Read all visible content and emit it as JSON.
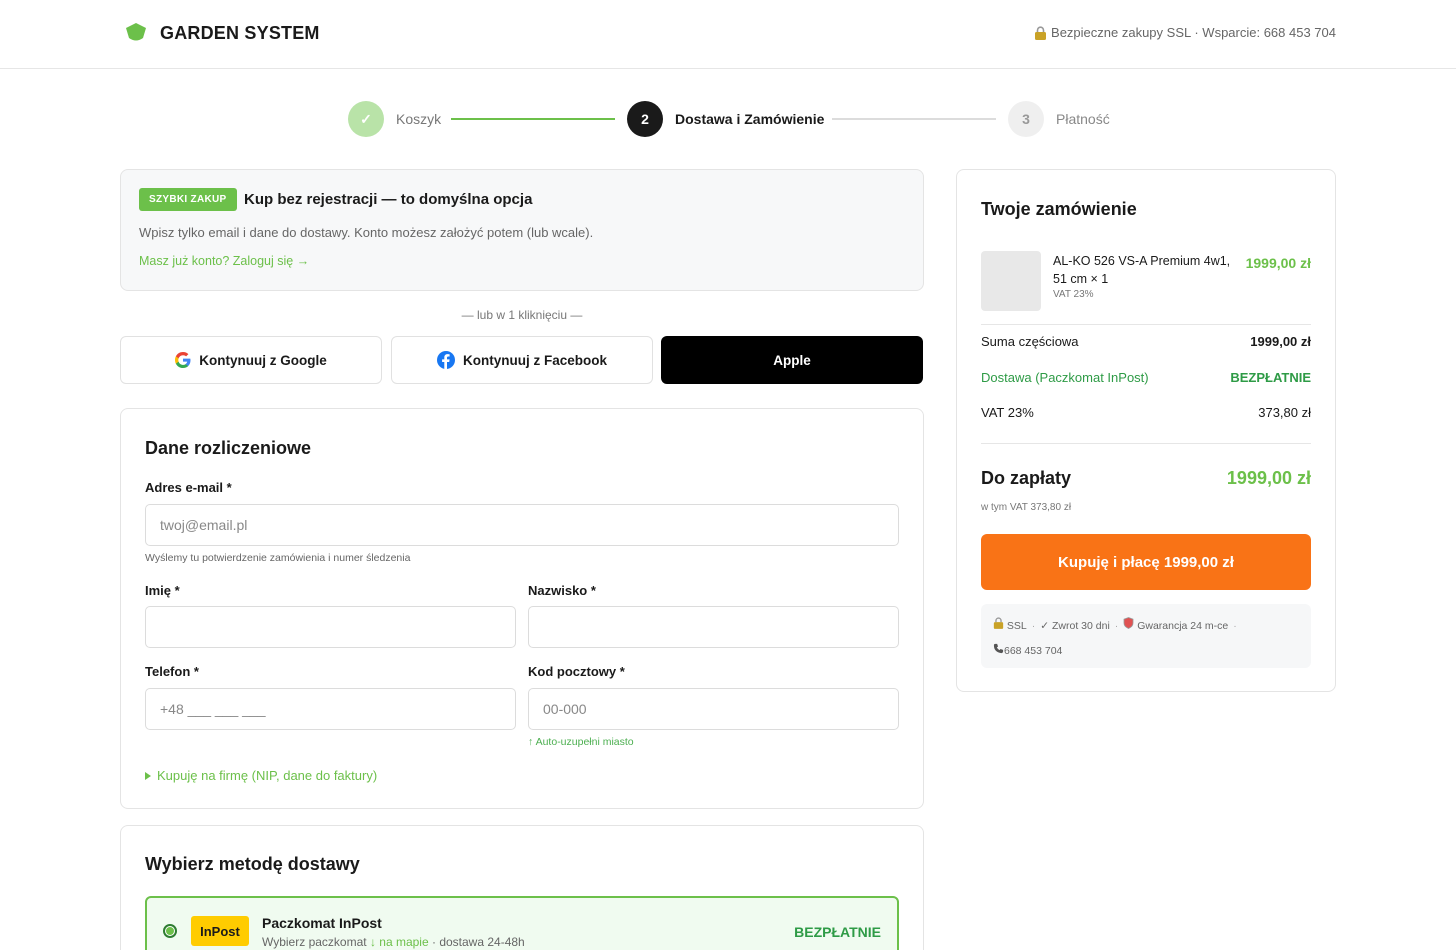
{
  "header": {
    "brand": "GARDEN SYSTEM",
    "info": "Bezpieczne zakupy SSL · Wsparcie: 668 453 704"
  },
  "stepper": {
    "steps": [
      {
        "label": "Koszyk",
        "marker": "✓",
        "state": "done"
      },
      {
        "label": "Dostawa i Zamówienie",
        "marker": "2",
        "state": "active"
      },
      {
        "label": "Płatność",
        "marker": "3",
        "state": "pending"
      }
    ]
  },
  "quick": {
    "badge": "SZYBKI ZAKUP",
    "title": "Kup bez rejestracji — to domyślna opcja",
    "desc": "Wpisz tylko email i dane do dostawy. Konto możesz założyć potem (lub wcale).",
    "login_link": "Masz już konto? Zaloguj się →"
  },
  "divider": "— lub w 1 kliknięciu —",
  "social": {
    "google": "Kontynuuj z Google",
    "facebook": "Kontynuuj z Facebook",
    "apple": "Apple"
  },
  "billing": {
    "title": "Dane rozliczeniowe",
    "email_label": "Adres e-mail *",
    "email_placeholder": "twoj@email.pl",
    "email_hint": "Wyślemy tu potwierdzenie zamówienia i numer śledzenia",
    "first_name_label": "Imię *",
    "last_name_label": "Nazwisko *",
    "phone_label": "Telefon *",
    "phone_placeholder": "+48 ___ ___ ___",
    "zip_label": "Kod pocztowy *",
    "zip_placeholder": "00-000",
    "zip_hint": "↑ Auto-uzupełni miasto",
    "company_toggle": "Kupuję na firmę (NIP, dane do faktury)"
  },
  "delivery": {
    "title": "Wybierz metodę dostawy",
    "option": {
      "logo": "InPost",
      "name": "Paczkomat InPost",
      "sub_prefix": "Wybierz paczkomat",
      "sub_link": "↓ na mapie",
      "sub_suffix": "· dostawa 24-48h",
      "price": "BEZPŁATNIE"
    }
  },
  "summary": {
    "title": "Twoje zamówienie",
    "product": {
      "name": "AL-KO 526 VS-A Premium 4w1, 51 cm × 1",
      "vat": "VAT 23%",
      "price": "1999,00 zł"
    },
    "subtotal_label": "Suma częściowa",
    "subtotal_value": "1999,00 zł",
    "shipping_label": "Dostawa (Paczkomat InPost)",
    "shipping_value": "BEZPŁATNIE",
    "vat_label": "VAT 23%",
    "vat_value": "373,80 zł",
    "total_label": "Do zapłaty",
    "total_value": "1999,00 zł",
    "total_sub": "w tym VAT 373,80 zł",
    "buy_button": "Kupuję i płacę 1999,00 zł",
    "trust": {
      "ssl": "SSL",
      "returns": "✓ Zwrot 30 dni",
      "warranty": "Gwarancja 24 m-ce",
      "phone": "668 453 704"
    }
  },
  "colors": {
    "accent_green": "#6cc04a",
    "cta_orange": "#f97316",
    "dark": "#1a1a1a"
  }
}
